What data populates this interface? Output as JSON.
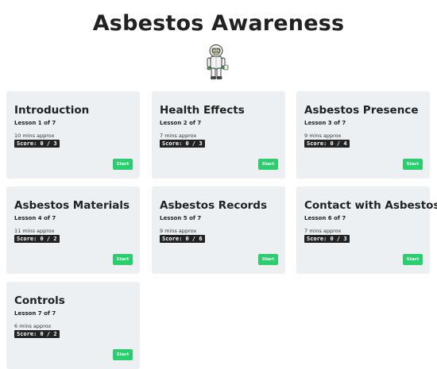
{
  "header": {
    "title": "Asbestos Awareness",
    "mascot_icon": "hazmat-worker-icon"
  },
  "lessons": [
    {
      "title": "Introduction",
      "lesson": "Lesson 1 of 7",
      "duration": "10 mins approx",
      "score": "Score: 0 / 3",
      "button": "Start"
    },
    {
      "title": "Health Effects",
      "lesson": "Lesson 2 of 7",
      "duration": "7 mins approx",
      "score": "Score: 0 / 3",
      "button": "Start"
    },
    {
      "title": "Asbestos Presence",
      "lesson": "Lesson 3 of 7",
      "duration": "9 mins approx",
      "score": "Score: 0 / 4",
      "button": "Start"
    },
    {
      "title": "Asbestos Materials",
      "lesson": "Lesson 4 of 7",
      "duration": "11 mins approx",
      "score": "Score: 0 / 2",
      "button": "Start"
    },
    {
      "title": "Asbestos Records",
      "lesson": "Lesson 5 of 7",
      "duration": "9 mins approx",
      "score": "Score: 0 / 6",
      "button": "Start"
    },
    {
      "title": "Contact with Asbestos",
      "lesson": "Lesson 6 of 7",
      "duration": "7 mins approx",
      "score": "Score: 0 / 3",
      "button": "Start"
    },
    {
      "title": "Controls",
      "lesson": "Lesson 7 of 7",
      "duration": "6 mins approx",
      "score": "Score: 0 / 2",
      "button": "Start"
    }
  ],
  "colors": {
    "card_background": "#edf0f2",
    "start_button": "#2ecc71",
    "score_badge": "#222222"
  }
}
